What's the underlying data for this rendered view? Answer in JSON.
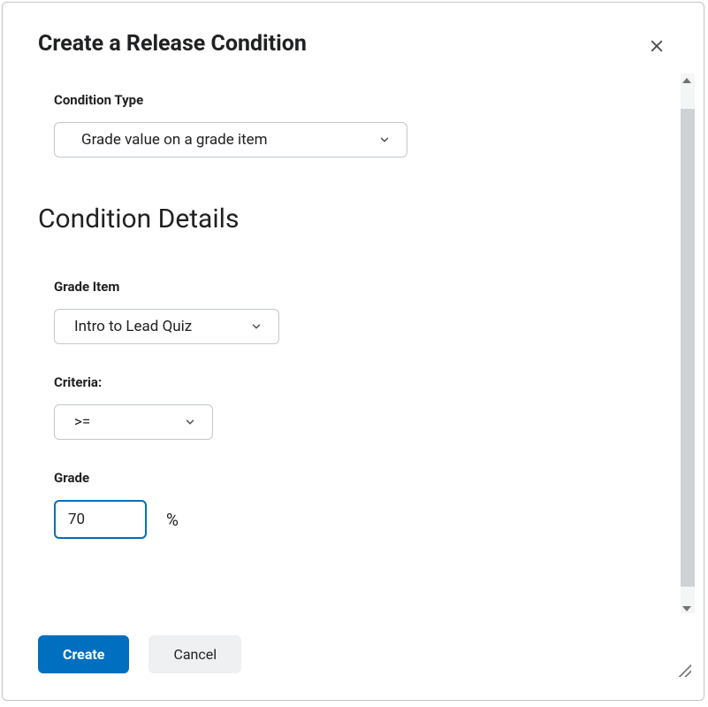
{
  "modal": {
    "title": "Create a Release Condition"
  },
  "conditionType": {
    "label": "Condition Type",
    "value": "Grade value on a grade item"
  },
  "sectionHeading": "Condition Details",
  "gradeItem": {
    "label": "Grade Item",
    "value": "Intro to Lead Quiz"
  },
  "criteria": {
    "label": "Criteria:",
    "value": ">="
  },
  "grade": {
    "label": "Grade",
    "value": "70",
    "unit": "%"
  },
  "buttons": {
    "create": "Create",
    "cancel": "Cancel"
  }
}
